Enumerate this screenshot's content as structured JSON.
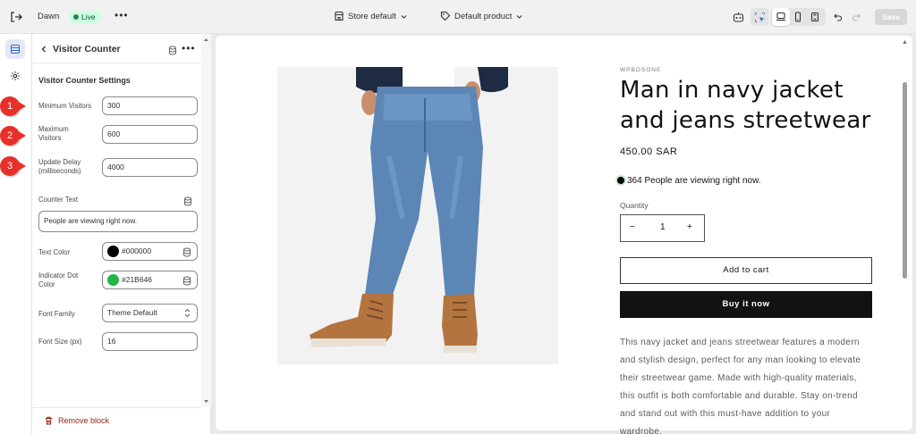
{
  "topbar": {
    "theme_name": "Dawn",
    "live_badge": "Live",
    "store_select": "Store default",
    "template_select": "Default product",
    "save_label": "Save"
  },
  "panel": {
    "header_title": "Visitor Counter",
    "section_title": "Visitor Counter Settings",
    "fields": {
      "min_visitors": {
        "label": "Minimum Visitors",
        "value": "300"
      },
      "max_visitors": {
        "label": "Maximum Visitors",
        "value": "600"
      },
      "update_delay": {
        "label": "Update Delay (milliseconds)",
        "value": "4000"
      },
      "counter_text": {
        "label": "Counter Text",
        "value": "People are viewing right now."
      },
      "text_color": {
        "label": "Text Color",
        "value": "#000000"
      },
      "dot_color": {
        "label": "Indicator Dot Color",
        "value": "#21B646"
      },
      "font_family": {
        "label": "Font Family",
        "value": "Theme Default"
      },
      "font_size": {
        "label": "Font Size (px)",
        "value": "16"
      }
    },
    "remove_label": "Remove block"
  },
  "annotations": [
    "1",
    "2",
    "3"
  ],
  "product": {
    "vendor": "WPBOSONE",
    "title": "Man in navy jacket and jeans streetwear",
    "price": "450.00 SAR",
    "viewers_count": "364",
    "viewers_text": "People are viewing right now.",
    "quantity_label": "Quantity",
    "quantity_value": "1",
    "add_to_cart": "Add to cart",
    "buy_now": "Buy it now",
    "description": "This navy jacket and jeans streetwear features a modern and stylish design, perfect for any man looking to elevate their streetwear game. Made with high-quality materials, this outfit is both comfortable and durable. Stay on-trend and stand out with this must-have addition to your wardrobe."
  },
  "colors": {
    "text_color": "#000000",
    "dot_color": "#21B646",
    "remove": "#8e1f0b",
    "annotation": "#e8302a"
  }
}
